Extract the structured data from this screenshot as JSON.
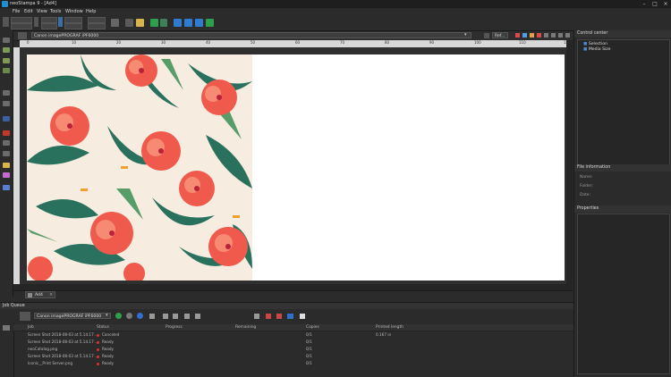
{
  "window": {
    "title": "neoStampa 9 - [Ad4]"
  },
  "menu": [
    "File",
    "Edit",
    "View",
    "Tools",
    "Window",
    "Help"
  ],
  "editor": {
    "printer_combo": "Canon imagePROGRAF iPF6000",
    "zoom_value": "Ref...",
    "ruler_labels": [
      "0",
      "10",
      "20",
      "30",
      "40",
      "50",
      "60",
      "70",
      "80",
      "90",
      "100",
      "110",
      "120"
    ],
    "doc_tab": "Ad4"
  },
  "control_center": {
    "title": "Control center",
    "tree": [
      "Selection",
      "Media Size"
    ],
    "file_info_title": "File information",
    "file_info_fields": [
      "Name:",
      "Folder:",
      "Date:"
    ],
    "properties_title": "Properties"
  },
  "job_queue": {
    "title": "Job Queue",
    "printer_combo": "Canon imagePROGRAF iPF6000",
    "columns": [
      "Job",
      "Status",
      "Progress",
      "Remaining",
      "Copies",
      "Printed length"
    ],
    "rows": [
      {
        "job": "Screen Shot 2018-08-03 at 5.14.17 ...",
        "status": "Canceled",
        "copies": "0/1",
        "printed": "0.167 in"
      },
      {
        "job": "Screen Shot 2018-08-03 at 5.14.17 ...",
        "status": "Ready",
        "copies": "0/1",
        "printed": ""
      },
      {
        "job": "neoCatalog.png",
        "status": "Ready",
        "copies": "0/1",
        "printed": ""
      },
      {
        "job": "Screen Shot 2018-08-03 at 5.14.17 ...",
        "status": "Ready",
        "copies": "0/1",
        "printed": ""
      },
      {
        "job": "Iconic__Print Server.png",
        "status": "Ready",
        "copies": "0/1",
        "printed": ""
      }
    ]
  },
  "colors": {
    "bg": "#2b2b2b",
    "accent_blue": "#1f8fd1",
    "status_red": "#e03030",
    "hibiscus": "#ef5a4c",
    "leaf": "#1f6b57"
  }
}
